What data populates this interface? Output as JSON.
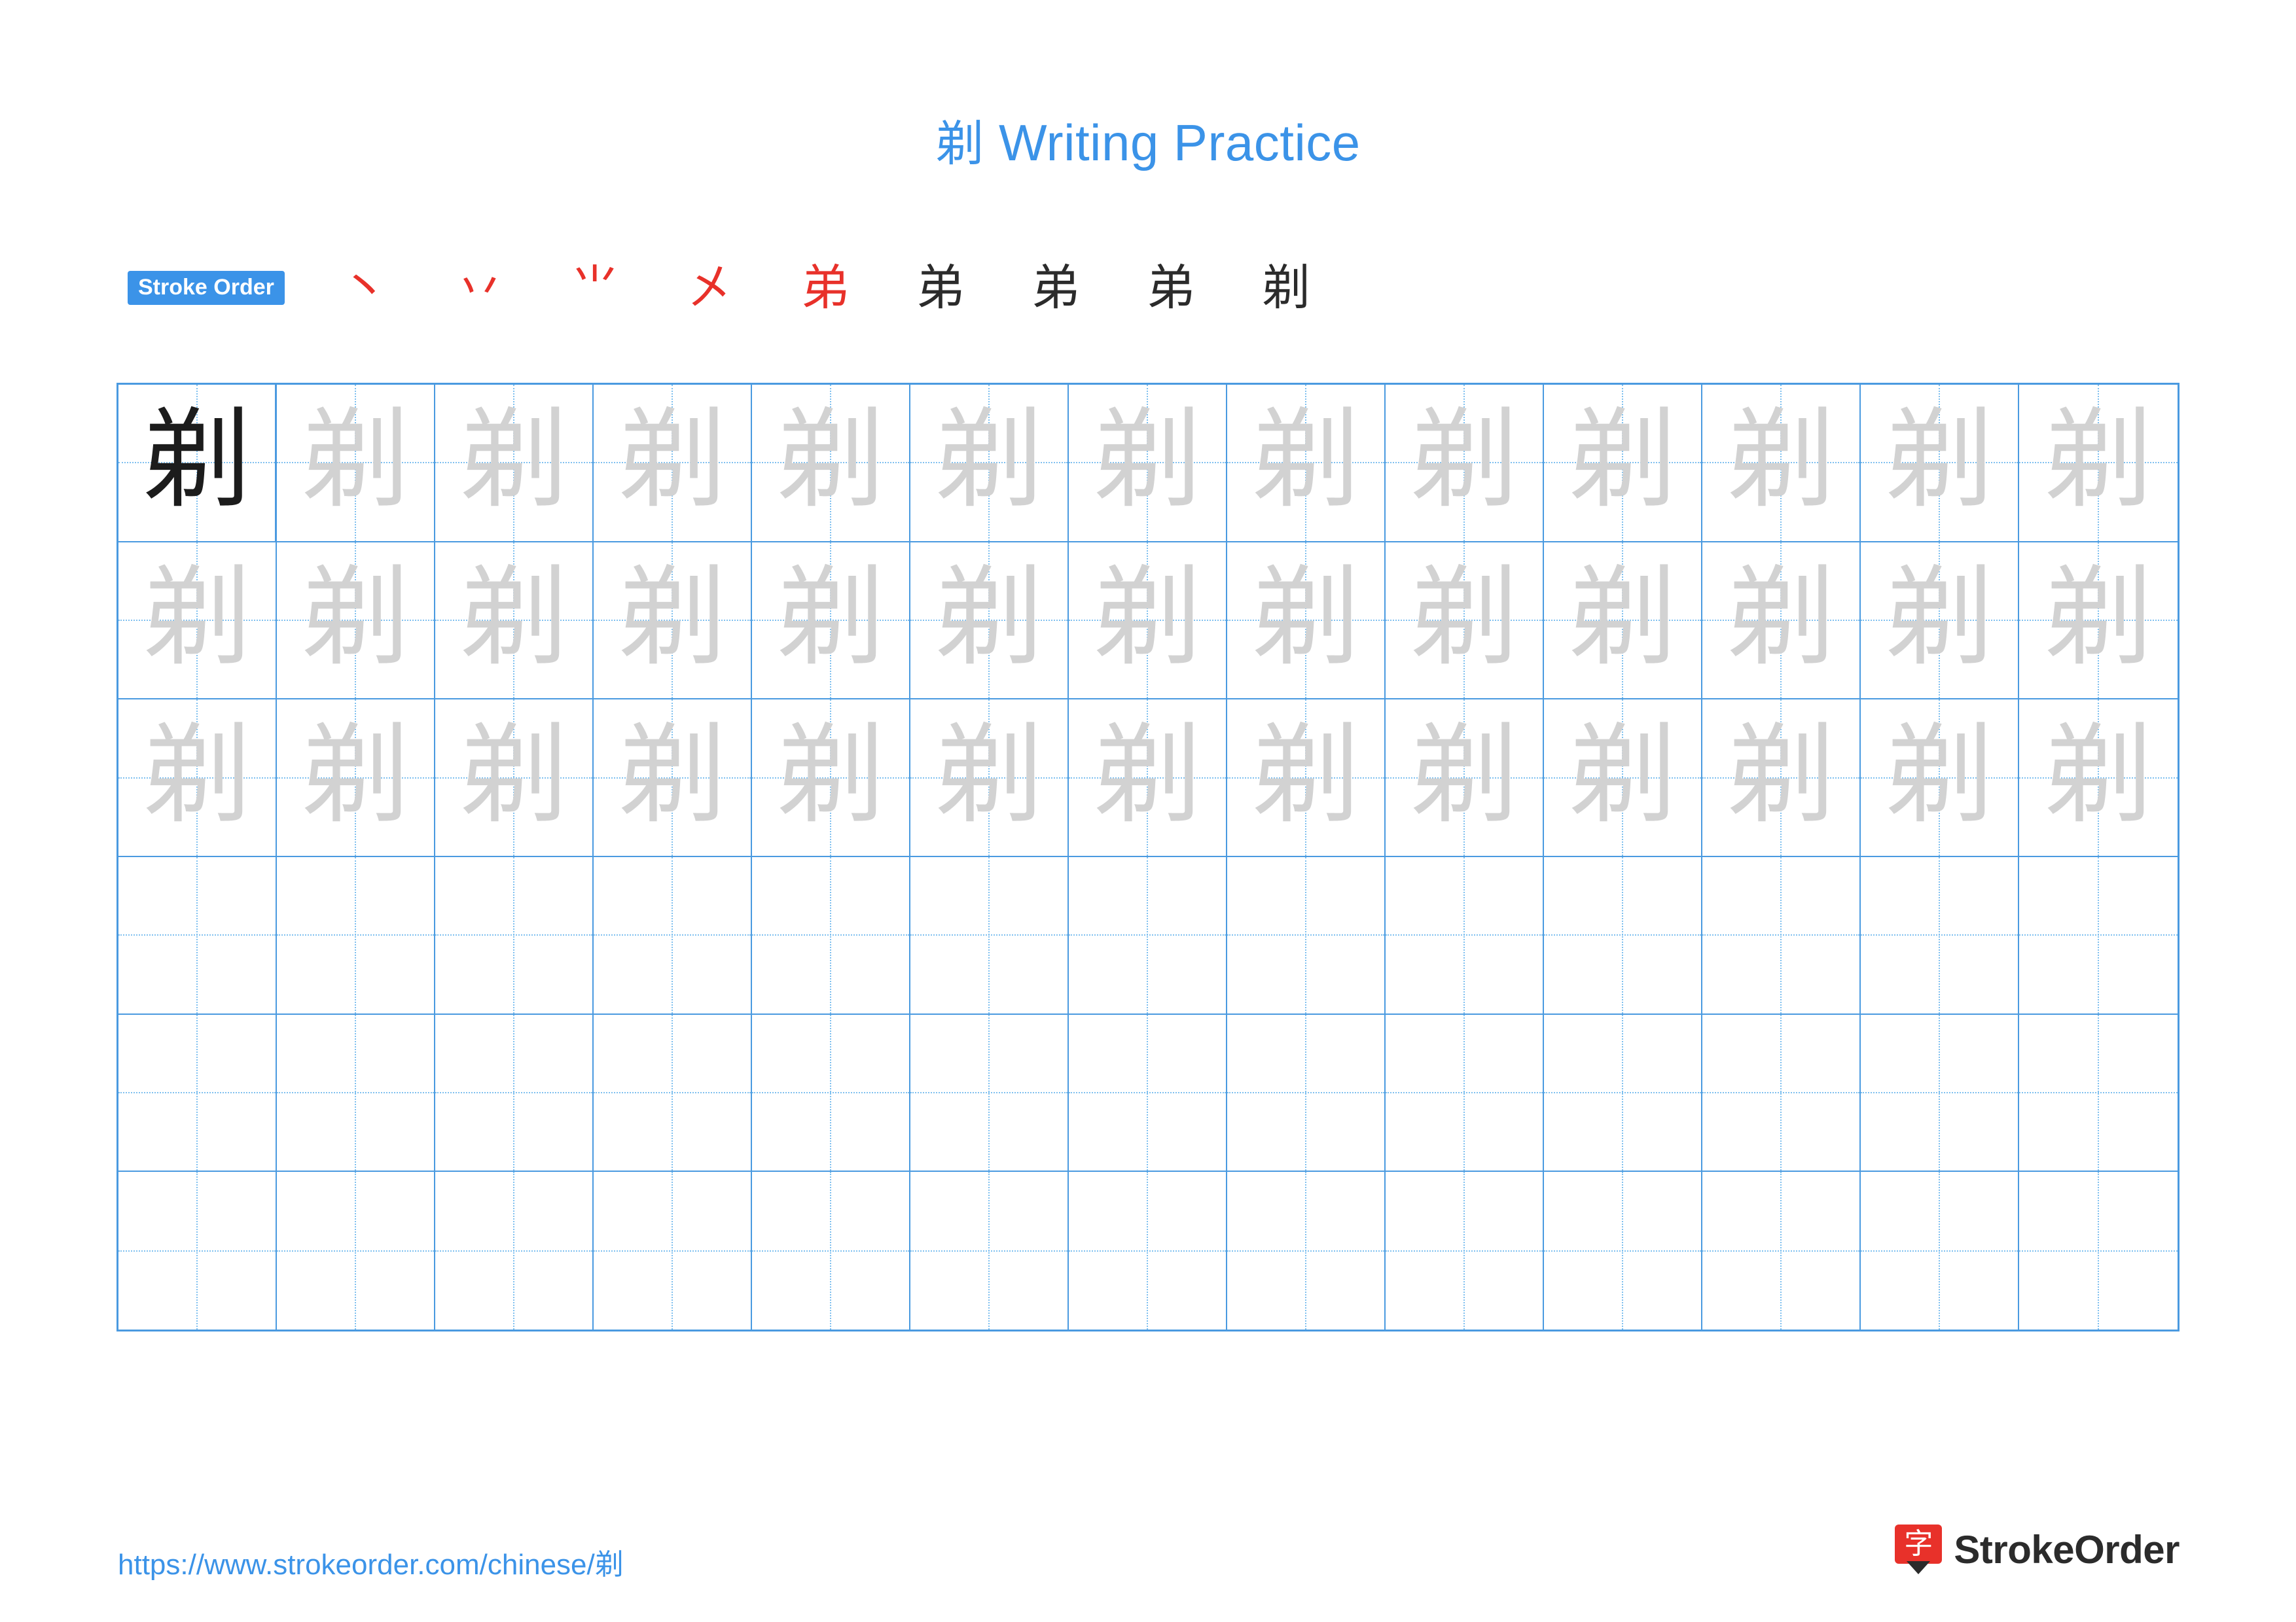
{
  "page": {
    "character": "剃",
    "title_suffix": " Writing Practice",
    "title_full": "剃 Writing Practice",
    "accent_color": "#3b93e8",
    "stroke_color": "#e8312a",
    "trace_color": "#d2d2d2"
  },
  "stroke_order": {
    "badge_label": "Stroke Order",
    "steps": [
      {
        "index": 1,
        "glyph": "丶",
        "color": "#e8312a"
      },
      {
        "index": 2,
        "glyph": "丷",
        "color": "#e8312a"
      },
      {
        "index": 3,
        "glyph": "⺌",
        "color": "#e8312a"
      },
      {
        "index": 4,
        "glyph": "㐅",
        "color": "#e8312a"
      },
      {
        "index": 5,
        "glyph": "弟",
        "color": "#e8312a"
      },
      {
        "index": 6,
        "glyph": "弟",
        "color": "#2b2b2b"
      },
      {
        "index": 7,
        "glyph": "弟",
        "color": "#2b2b2b"
      },
      {
        "index": 8,
        "glyph": "弟",
        "color": "#2b2b2b"
      },
      {
        "index": 9,
        "glyph": "剃",
        "color": "#2b2b2b"
      }
    ]
  },
  "practice_grid": {
    "columns": 13,
    "rows": 6,
    "model_character": "剃",
    "trace_character": "剃",
    "row_fill": [
      {
        "row": 1,
        "model": true,
        "traced_cells": 12
      },
      {
        "row": 2,
        "model": false,
        "traced_cells": 13
      },
      {
        "row": 3,
        "model": false,
        "traced_cells": 13
      },
      {
        "row": 4,
        "model": false,
        "traced_cells": 0
      },
      {
        "row": 5,
        "model": false,
        "traced_cells": 0
      },
      {
        "row": 6,
        "model": false,
        "traced_cells": 0
      }
    ]
  },
  "footer": {
    "url": "https://www.strokeorder.com/chinese/剃",
    "brand_name": "StrokeOrder",
    "brand_logo_char": "字"
  }
}
